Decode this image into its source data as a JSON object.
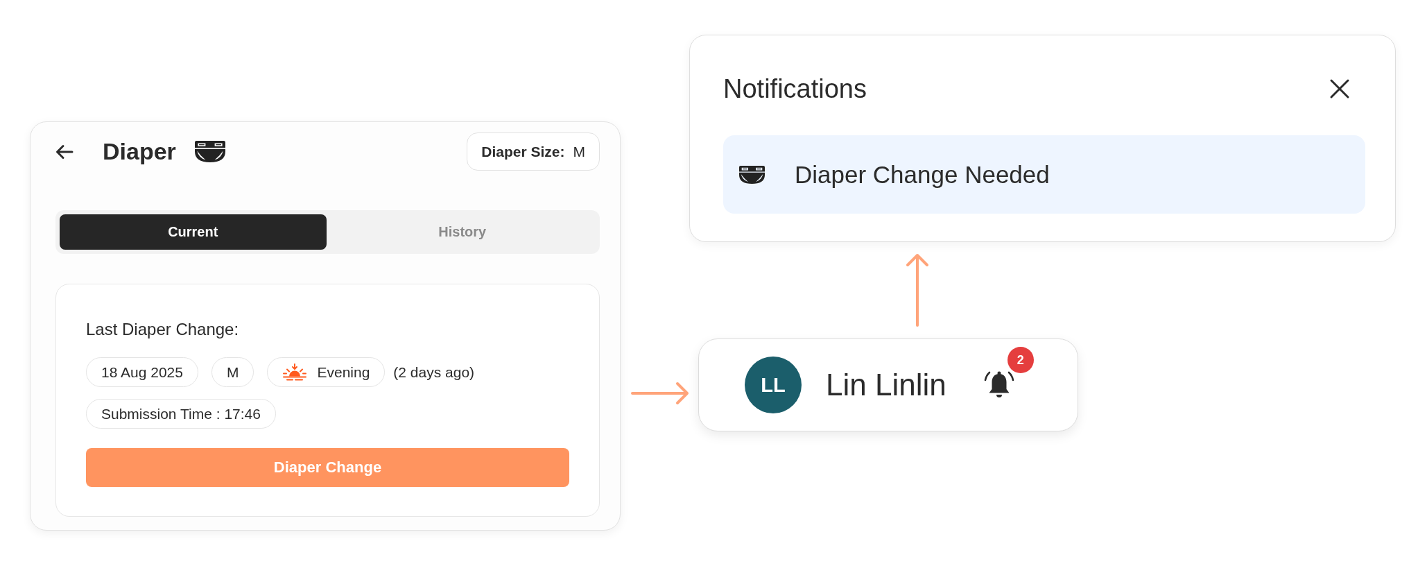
{
  "diaper_screen": {
    "title": "Diaper",
    "size": {
      "label": "Diaper Size:",
      "value": "M"
    },
    "tabs": [
      {
        "label": "Current",
        "selected": true
      },
      {
        "label": "History",
        "selected": false
      }
    ],
    "last_change": {
      "heading": "Last Diaper Change:",
      "chips": [
        {
          "kind": "text",
          "label": "18 Aug 2025"
        },
        {
          "kind": "text",
          "label": "M"
        },
        {
          "kind": "time_of_day",
          "label": "Evening"
        }
      ],
      "relative_time": "(2 days ago)",
      "submission_time": "Submission Time : 17:46"
    },
    "action_button": "Diaper Change"
  },
  "notifications": {
    "title": "Notifications",
    "items": [
      {
        "text": "Diaper Change Needed"
      }
    ]
  },
  "user_chip": {
    "initials": "LL",
    "name": "Lin Linlin",
    "badge_count": "2"
  }
}
